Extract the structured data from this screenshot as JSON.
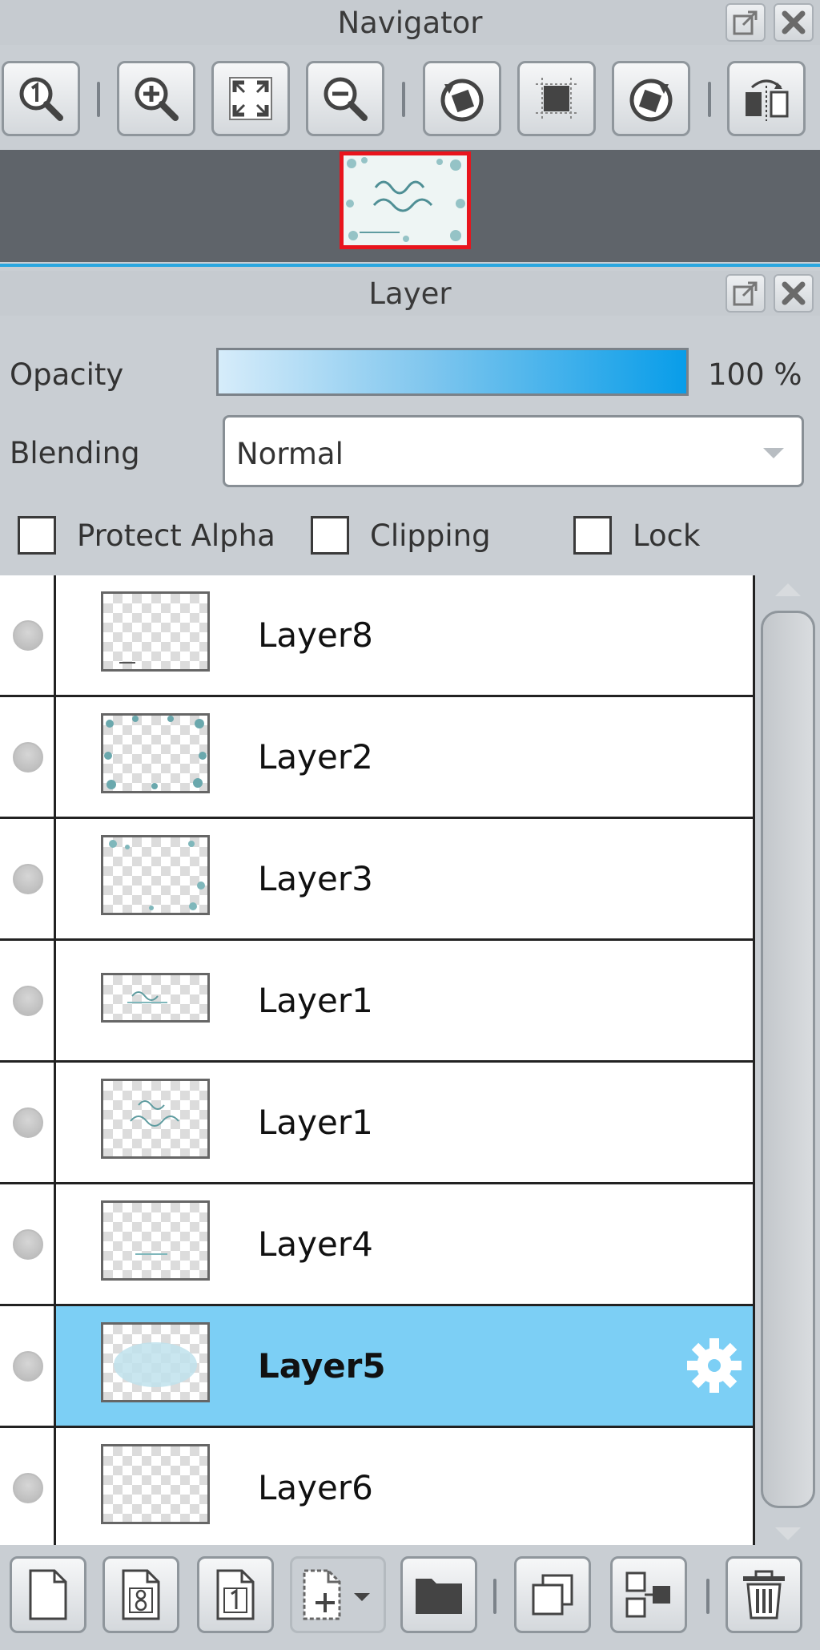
{
  "navigator": {
    "title": "Navigator",
    "toolbar": [
      {
        "name": "zoom-actual-size-button",
        "icon": "magnifier-1-icon"
      },
      {
        "name": "zoom-in-button",
        "icon": "magnifier-plus-icon"
      },
      {
        "name": "fit-to-window-button",
        "icon": "fit-arrows-icon"
      },
      {
        "name": "zoom-out-button",
        "icon": "magnifier-minus-icon"
      },
      {
        "name": "rotate-left-button",
        "icon": "rotate-ccw-icon"
      },
      {
        "name": "reset-view-button",
        "icon": "frame-icon"
      },
      {
        "name": "rotate-right-button",
        "icon": "rotate-cw-icon"
      },
      {
        "name": "flip-horizontal-button",
        "icon": "flip-icon"
      }
    ]
  },
  "layer_panel": {
    "title": "Layer",
    "opacity_label": "Opacity",
    "opacity_value": "100 %",
    "opacity_fraction": 1.0,
    "blending_label": "Blending",
    "blending_value": "Normal",
    "checks": {
      "protect_alpha": "Protect Alpha",
      "clipping": "Clipping",
      "lock": "Lock"
    },
    "layers": [
      {
        "name": "Layer8",
        "selected": false
      },
      {
        "name": "Layer2",
        "selected": false
      },
      {
        "name": "Layer3",
        "selected": false
      },
      {
        "name": "Layer1",
        "selected": false
      },
      {
        "name": "Layer1",
        "selected": false
      },
      {
        "name": "Layer4",
        "selected": false
      },
      {
        "name": "Layer5",
        "selected": true
      },
      {
        "name": "Layer6",
        "selected": false
      }
    ],
    "bottom_toolbar": [
      {
        "name": "new-layer-button",
        "icon": "page-icon"
      },
      {
        "name": "new-8bit-layer-button",
        "icon": "page-8-icon"
      },
      {
        "name": "new-1bit-layer-button",
        "icon": "page-1-icon"
      },
      {
        "name": "add-layer-menu-button",
        "icon": "page-plus-dropdown-icon"
      },
      {
        "name": "new-folder-button",
        "icon": "folder-icon"
      },
      {
        "name": "duplicate-layer-button",
        "icon": "duplicate-icon"
      },
      {
        "name": "merge-down-button",
        "icon": "merge-icon"
      },
      {
        "name": "delete-layer-button",
        "icon": "trash-icon"
      }
    ]
  },
  "colors": {
    "selection": "#7ccff5",
    "accent": "#2aa7e0",
    "navigator_frame": "#e8141c"
  }
}
